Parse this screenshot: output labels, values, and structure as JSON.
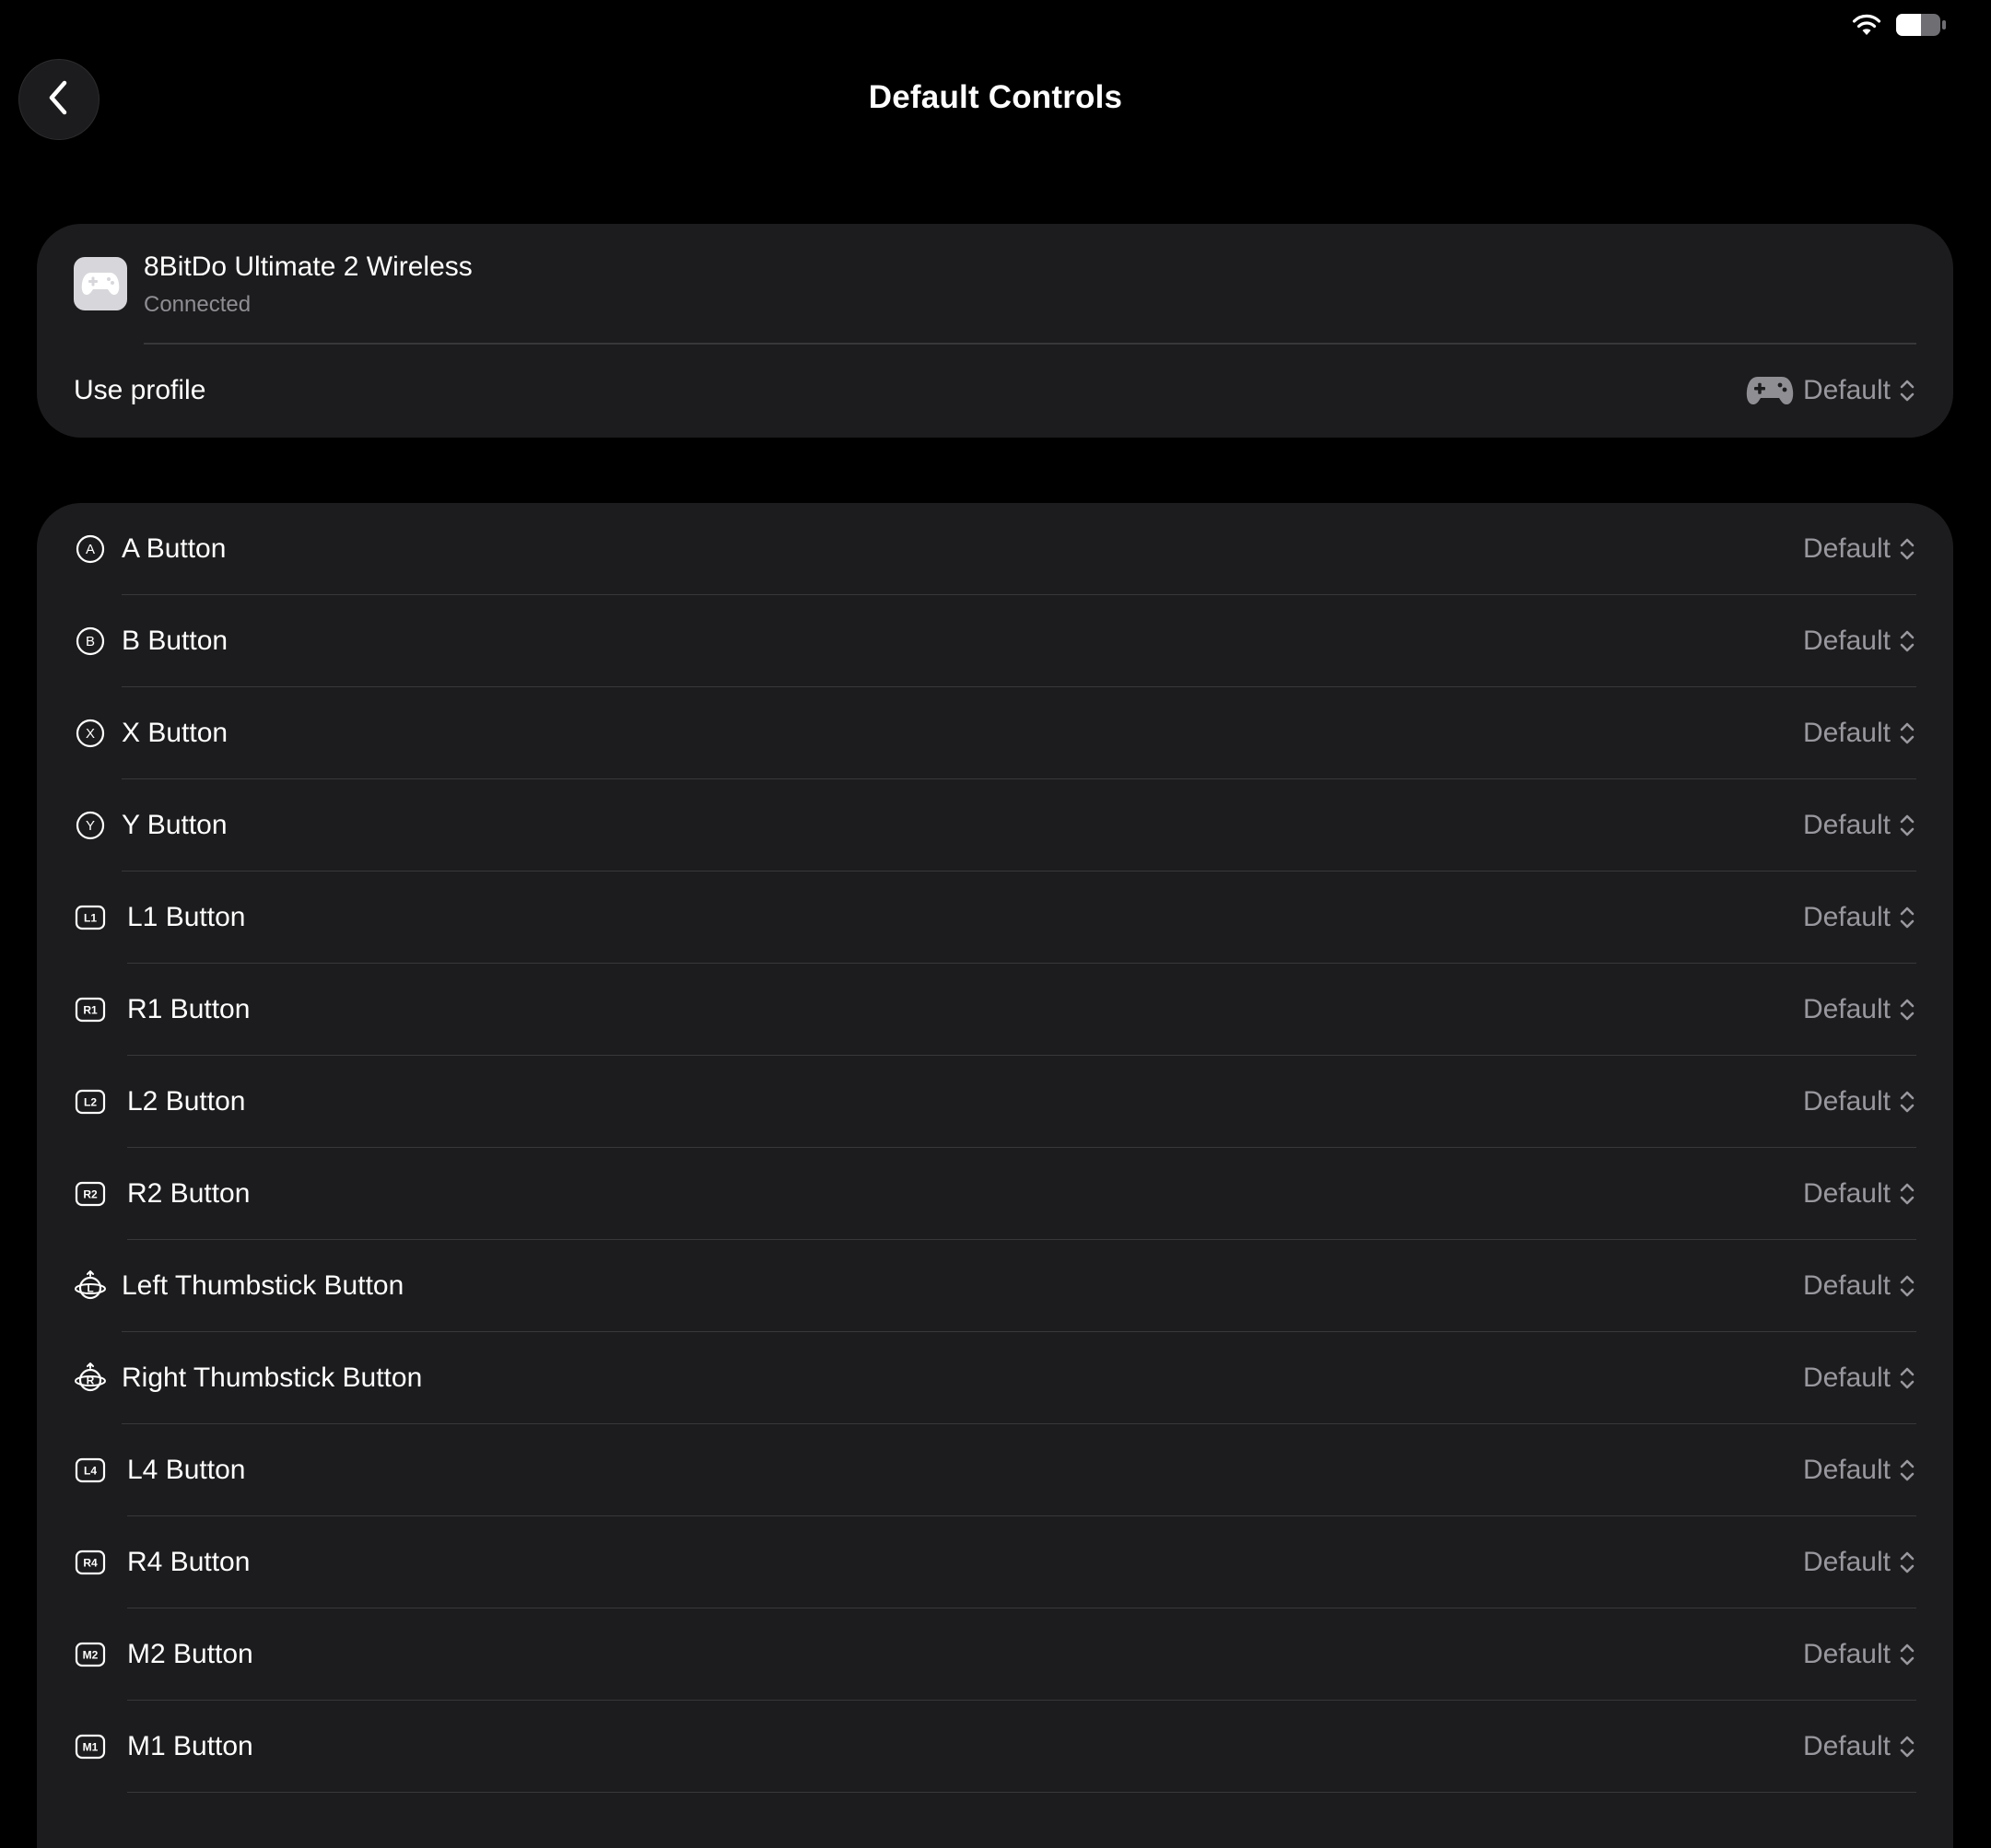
{
  "header": {
    "title": "Default Controls"
  },
  "device": {
    "name": "8BitDo Ultimate 2 Wireless",
    "status": "Connected",
    "profile_label": "Use profile",
    "profile_value": "Default"
  },
  "buttons": [
    {
      "label": "A Button",
      "value": "Default",
      "glyph": "A",
      "icon": "a-button-icon"
    },
    {
      "label": "B Button",
      "value": "Default",
      "glyph": "B",
      "icon": "b-button-icon"
    },
    {
      "label": "X Button",
      "value": "Default",
      "glyph": "X",
      "icon": "x-button-icon"
    },
    {
      "label": "Y Button",
      "value": "Default",
      "glyph": "Y",
      "icon": "y-button-icon"
    },
    {
      "label": "L1 Button",
      "value": "Default",
      "glyph": "L1",
      "icon": "l1-button-icon"
    },
    {
      "label": "R1 Button",
      "value": "Default",
      "glyph": "R1",
      "icon": "r1-button-icon"
    },
    {
      "label": "L2 Button",
      "value": "Default",
      "glyph": "L2",
      "icon": "l2-button-icon"
    },
    {
      "label": "R2 Button",
      "value": "Default",
      "glyph": "R2",
      "icon": "r2-button-icon"
    },
    {
      "label": "Left Thumbstick Button",
      "value": "Default",
      "glyph": "L",
      "icon": "left-thumbstick-icon"
    },
    {
      "label": "Right Thumbstick Button",
      "value": "Default",
      "glyph": "R",
      "icon": "right-thumbstick-icon"
    },
    {
      "label": "L4 Button",
      "value": "Default",
      "glyph": "L4",
      "icon": "l4-button-icon"
    },
    {
      "label": "R4 Button",
      "value": "Default",
      "glyph": "R4",
      "icon": "r4-button-icon"
    },
    {
      "label": "M2 Button",
      "value": "Default",
      "glyph": "M2",
      "icon": "m2-button-icon"
    },
    {
      "label": "M1 Button",
      "value": "Default",
      "glyph": "M1",
      "icon": "m1-button-icon"
    }
  ],
  "colors": {
    "background": "#000000",
    "card": "#1c1c1e",
    "separator": "#38383a",
    "secondary_text": "#98989e"
  }
}
